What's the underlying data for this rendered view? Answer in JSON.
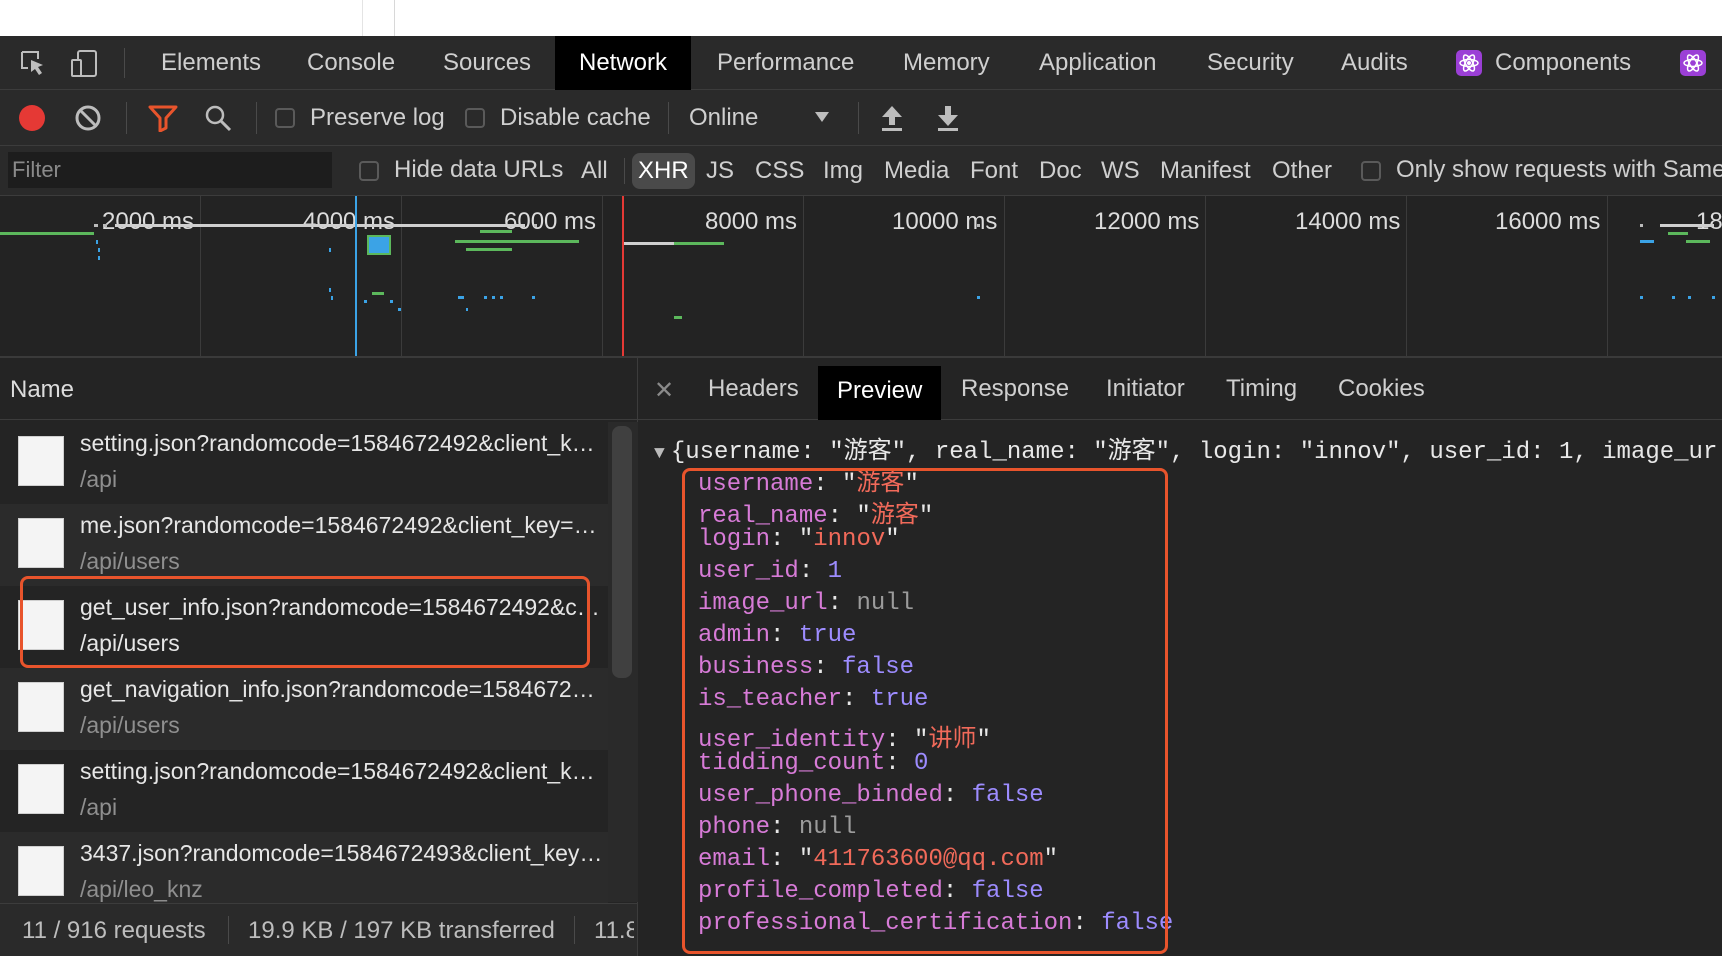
{
  "devtools_tabs": [
    "Elements",
    "Console",
    "Sources",
    "Network",
    "Performance",
    "Memory",
    "Application",
    "Security",
    "Audits",
    "Components"
  ],
  "active_tab": "Network",
  "toolbar": {
    "preserve_log": "Preserve log",
    "disable_cache": "Disable cache",
    "throttle": "Online"
  },
  "filter": {
    "placeholder": "Filter",
    "hide_data_urls": "Hide data URLs",
    "types": [
      "All",
      "XHR",
      "JS",
      "CSS",
      "Img",
      "Media",
      "Font",
      "Doc",
      "WS",
      "Manifest",
      "Other"
    ],
    "active_type": "XHR",
    "same_site": "Only show requests with Same"
  },
  "timeline": {
    "ticks": [
      "2000 ms",
      "4000 ms",
      "6000 ms",
      "8000 ms",
      "10000 ms",
      "12000 ms",
      "14000 ms",
      "16000 ms",
      "18"
    ]
  },
  "name_panel": {
    "header": "Name",
    "requests": [
      {
        "name": "setting.json?randomcode=1584672492&client_k…",
        "path": "/api"
      },
      {
        "name": "me.json?randomcode=1584672492&client_key=…",
        "path": "/api/users"
      },
      {
        "name": "get_user_info.json?randomcode=1584672492&c…",
        "path": "/api/users"
      },
      {
        "name": "get_navigation_info.json?randomcode=1584672…",
        "path": "/api/users"
      },
      {
        "name": "setting.json?randomcode=1584672492&client_k…",
        "path": "/api"
      },
      {
        "name": "3437.json?randomcode=1584672493&client_key…",
        "path": "/api/leo_knz"
      }
    ],
    "selected_index": 2
  },
  "status": {
    "requests": "11 / 916 requests",
    "transferred": "19.9 KB / 197 KB transferred",
    "resources": "11.8"
  },
  "detail_tabs": [
    "Headers",
    "Preview",
    "Response",
    "Initiator",
    "Timing",
    "Cookies"
  ],
  "active_detail_tab": "Preview",
  "preview": {
    "summary": "{username: \"游客\", real_name: \"游客\", login: \"innov\", user_id: 1, image_ur",
    "props": {
      "p0": {
        "key": "username",
        "val": "游客"
      },
      "p1": {
        "key": "real_name",
        "val": "游客"
      },
      "p2": {
        "key": "login",
        "val": "innov"
      },
      "p3": {
        "key": "user_id",
        "val": "1"
      },
      "p4": {
        "key": "image_url",
        "val": "null"
      },
      "p5": {
        "key": "admin",
        "val": "true"
      },
      "p6": {
        "key": "business",
        "val": "false"
      },
      "p7": {
        "key": "is_teacher",
        "val": "true"
      },
      "p8": {
        "key": "user_identity",
        "val": "讲师"
      },
      "p9": {
        "key": "tidding_count",
        "val": "0"
      },
      "p10": {
        "key": "user_phone_binded",
        "val": "false"
      },
      "p11": {
        "key": "phone",
        "val": "null"
      },
      "p12": {
        "key": "email",
        "val": "411763600@qq.com"
      },
      "p13": {
        "key": "profile_completed",
        "val": "false"
      },
      "p14": {
        "key": "professional_certification",
        "val": "false"
      }
    }
  },
  "colors": {
    "highlight": "#e8542c",
    "record": "#e53935",
    "filter_icon": "#e8542c"
  }
}
